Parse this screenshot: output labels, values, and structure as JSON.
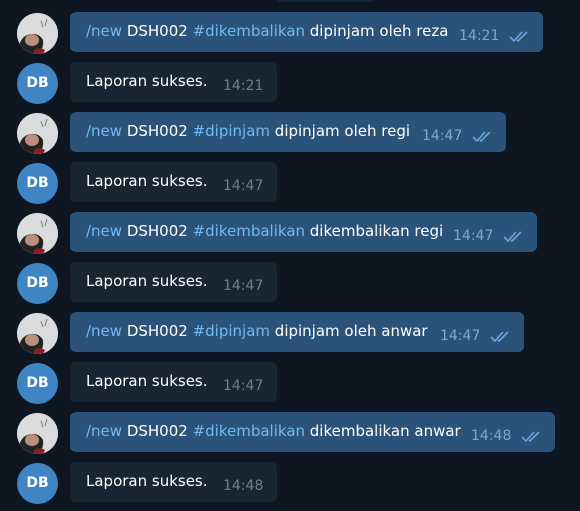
{
  "messages": [
    {
      "direction": "outgoing",
      "avatar_icon": "user-photo-icon",
      "command": "/new",
      "code": " DSH002 ",
      "hashtag": "#dikembalikan",
      "rest": " dipinjam oleh reza",
      "time": "14:21",
      "status_icon": "double-check-icon"
    },
    {
      "direction": "incoming",
      "avatar_initials": "DB",
      "text": "Laporan sukses.",
      "time": "14:21"
    },
    {
      "direction": "outgoing",
      "avatar_icon": "user-photo-icon",
      "command": "/new",
      "code": " DSH002 ",
      "hashtag": "#dipinjam",
      "rest": " dipinjam oleh regi",
      "time": "14:47",
      "status_icon": "double-check-icon"
    },
    {
      "direction": "incoming",
      "avatar_initials": "DB",
      "text": "Laporan sukses.",
      "time": "14:47"
    },
    {
      "direction": "outgoing",
      "avatar_icon": "user-photo-icon",
      "command": "/new",
      "code": " DSH002 ",
      "hashtag": "#dikembalikan",
      "rest": " dikembalikan regi",
      "time": "14:47",
      "status_icon": "double-check-icon"
    },
    {
      "direction": "incoming",
      "avatar_initials": "DB",
      "text": "Laporan sukses.",
      "time": "14:47"
    },
    {
      "direction": "outgoing",
      "avatar_icon": "user-photo-icon",
      "command": "/new",
      "code": " DSH002 ",
      "hashtag": "#dipinjam",
      "rest": " dipinjam oleh anwar",
      "time": "14:47",
      "status_icon": "double-check-icon"
    },
    {
      "direction": "incoming",
      "avatar_initials": "DB",
      "text": "Laporan sukses.",
      "time": "14:47"
    },
    {
      "direction": "outgoing",
      "avatar_icon": "user-photo-icon",
      "command": "/new",
      "code": " DSH002 ",
      "hashtag": "#dikembalikan",
      "rest": " dikembalikan anwar",
      "time": "14:48",
      "status_icon": "double-check-icon"
    },
    {
      "direction": "incoming",
      "avatar_initials": "DB",
      "text": "Laporan sukses.",
      "time": "14:48"
    }
  ],
  "colors": {
    "background": "#0e1621",
    "outgoing_bubble": "#2b5278",
    "incoming_bubble": "#182533",
    "link": "#71baf5",
    "bot_avatar": "#3f84c3"
  }
}
